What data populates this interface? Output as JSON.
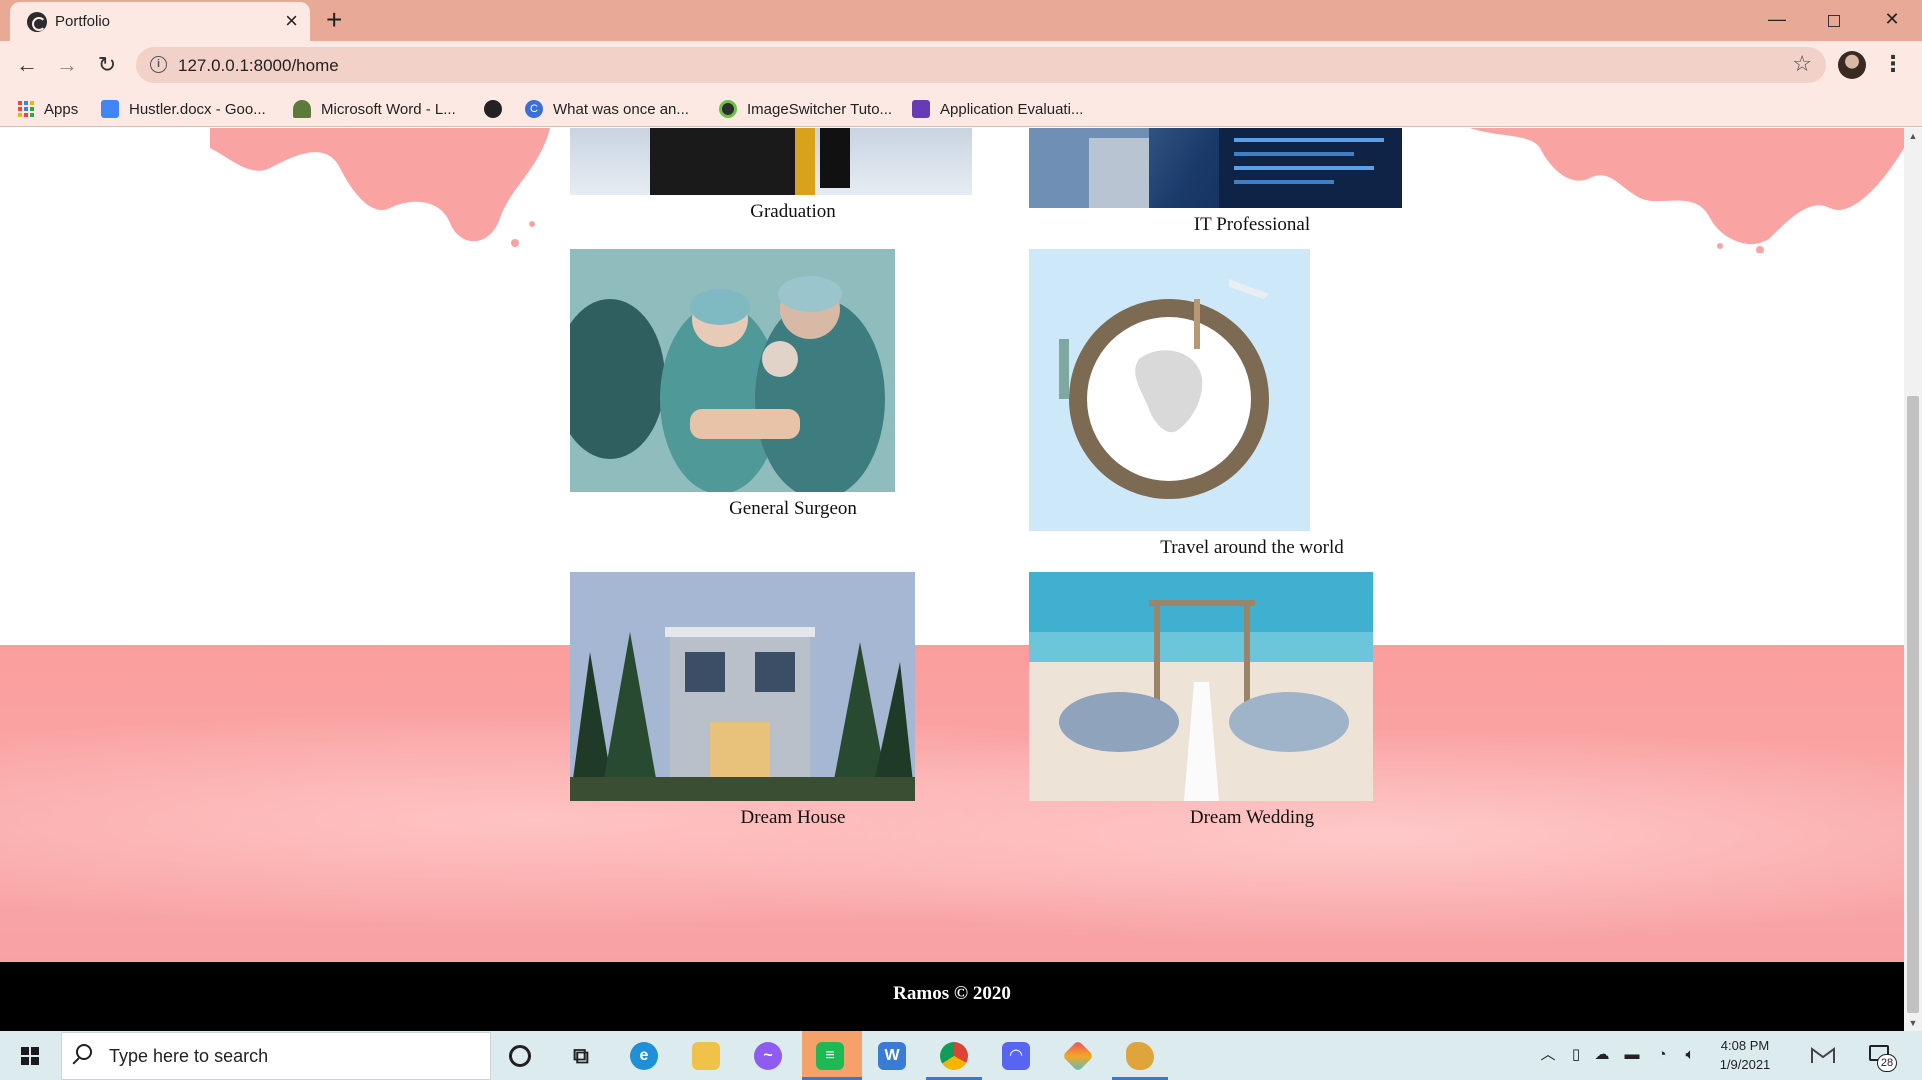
{
  "browser": {
    "tab_title": "Portfolio",
    "url": "127.0.0.1:8000/home",
    "bookmarks": [
      {
        "label": "Apps",
        "icon": "apps-grid-icon"
      },
      {
        "label": "Hustler.docx - Goo...",
        "icon": "google-docs-icon",
        "color": "#4285f4"
      },
      {
        "label": "Microsoft Word - L...",
        "icon": "tree-icon",
        "color": "#5c7a3a"
      },
      {
        "label": "",
        "icon": "github-icon",
        "color": "#222222"
      },
      {
        "label": "What was once an...",
        "icon": "c-icon",
        "color": "#3a6fd8"
      },
      {
        "label": "ImageSwitcher Tuto...",
        "icon": "android-icon",
        "color": "#2e2e2e"
      },
      {
        "label": "Application Evaluati...",
        "icon": "forms-icon",
        "color": "#673ab7"
      }
    ]
  },
  "page": {
    "portfolio_items": [
      {
        "caption": "Graduation"
      },
      {
        "caption": "IT Professional"
      },
      {
        "caption": "General Surgeon"
      },
      {
        "caption": "Travel around the world"
      },
      {
        "caption": "Dream House"
      },
      {
        "caption": "Dream Wedding"
      }
    ],
    "footer_text": "Ramos © 2020",
    "colors": {
      "accent_pink": "#f9a3a3",
      "footer_bg": "#000000",
      "chrome": "#e8a997"
    }
  },
  "taskbar": {
    "search_placeholder": "Type here to search",
    "time": "4:08 PM",
    "date": "1/9/2021",
    "notification_count": "28",
    "apps": [
      {
        "name": "cortana-icon"
      },
      {
        "name": "task-view-icon"
      },
      {
        "name": "edge-icon",
        "color": "#1f8fd8"
      },
      {
        "name": "file-explorer-icon",
        "color": "#f0c24a"
      },
      {
        "name": "messenger-icon",
        "color": "#8f5cf2"
      },
      {
        "name": "spotify-icon",
        "color": "#1db954"
      },
      {
        "name": "wps-writer-icon",
        "color": "#3a7bd5"
      },
      {
        "name": "chrome-icon",
        "color": "#db4437"
      },
      {
        "name": "discord-icon",
        "color": "#5865f2"
      },
      {
        "name": "gitkraken-icon",
        "color": "#e84a6b"
      },
      {
        "name": "paint-icon",
        "color": "#e0a43c"
      }
    ]
  }
}
